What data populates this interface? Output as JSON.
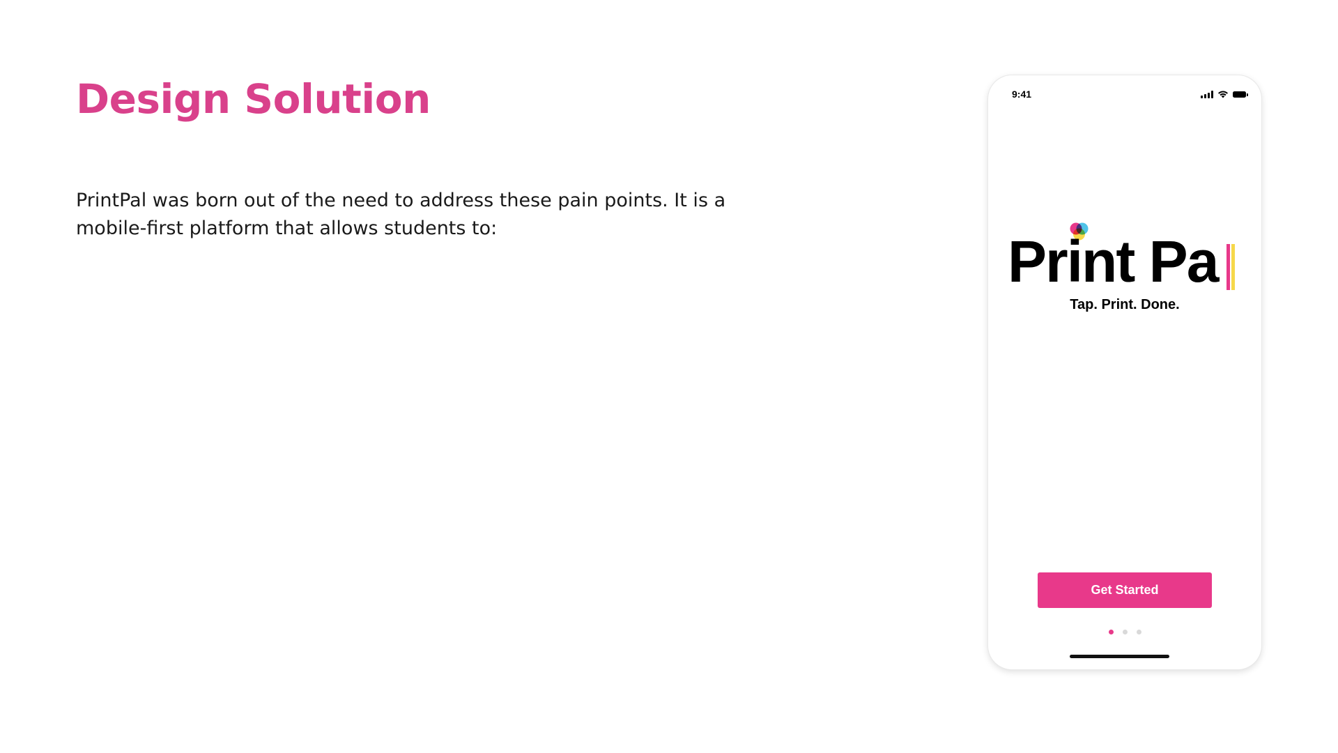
{
  "slide": {
    "title": "Design Solution",
    "body": "PrintPal was born out of the need to address these pain points. It is a mobile-first platform that allows students to:"
  },
  "phone": {
    "status_bar": {
      "time": "9:41",
      "icons": [
        "signal-icon",
        "wifi-icon",
        "battery-icon"
      ]
    },
    "logo": {
      "text": "Print Pa",
      "dot_colors": [
        "#E8398A",
        "#4FC3E8",
        "#F6D84A"
      ],
      "bar_colors": [
        "#E8398A",
        "#F6D84A"
      ]
    },
    "tagline": "Tap. Print. Done.",
    "cta_label": "Get Started",
    "pagination": {
      "total": 3,
      "active": 1
    }
  },
  "colors": {
    "accent": "#D9418B",
    "button": "#E8398A"
  }
}
